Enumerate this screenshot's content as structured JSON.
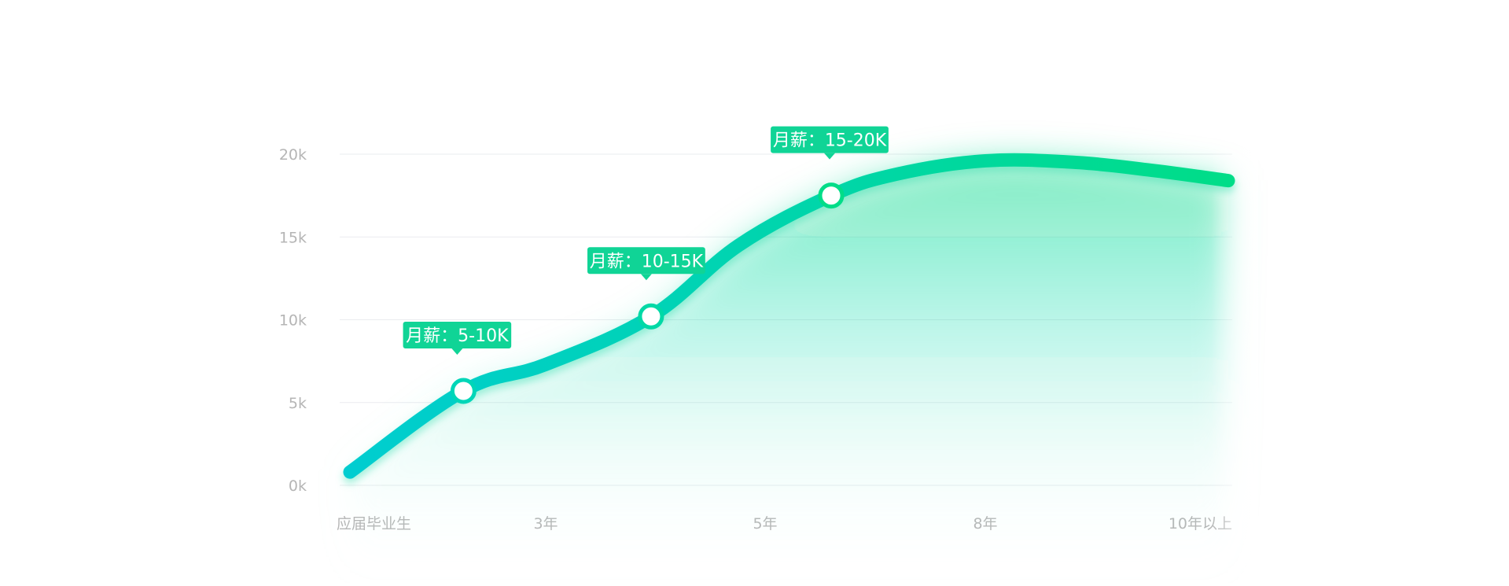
{
  "chart_data": {
    "type": "area",
    "title": "",
    "xlabel": "",
    "ylabel": "",
    "categories": [
      "应届毕业生",
      "3年",
      "5年",
      "8年",
      "10年以上"
    ],
    "y_ticks": [
      "0k",
      "5k",
      "10k",
      "15k",
      "20k"
    ],
    "ylim": [
      0,
      20000
    ],
    "grid": true,
    "legend": "none",
    "series": [
      {
        "x_positions": [
          0.0,
          0.52,
          1.0,
          1.48,
          1.88,
          2.3,
          2.6,
          3.0,
          3.4,
          3.75,
          4.0
        ],
        "values": [
          800,
          5700,
          7300,
          10200,
          14500,
          17500,
          18800,
          19600,
          19500,
          19000,
          18400
        ]
      }
    ],
    "markers": [
      {
        "x_position": 0.52,
        "value": 5700,
        "label": "月薪：5-10K"
      },
      {
        "x_position": 1.48,
        "value": 10200,
        "label": "月薪：10-15K"
      },
      {
        "x_position": 2.3,
        "value": 17500,
        "label": "月薪：15-20K"
      }
    ],
    "colors": {
      "line_start": "#00cdd0",
      "line_end": "#00dd88",
      "tooltip": "#10d496",
      "grid": "#eaecef",
      "tick_text": "#b5b5b5"
    }
  }
}
